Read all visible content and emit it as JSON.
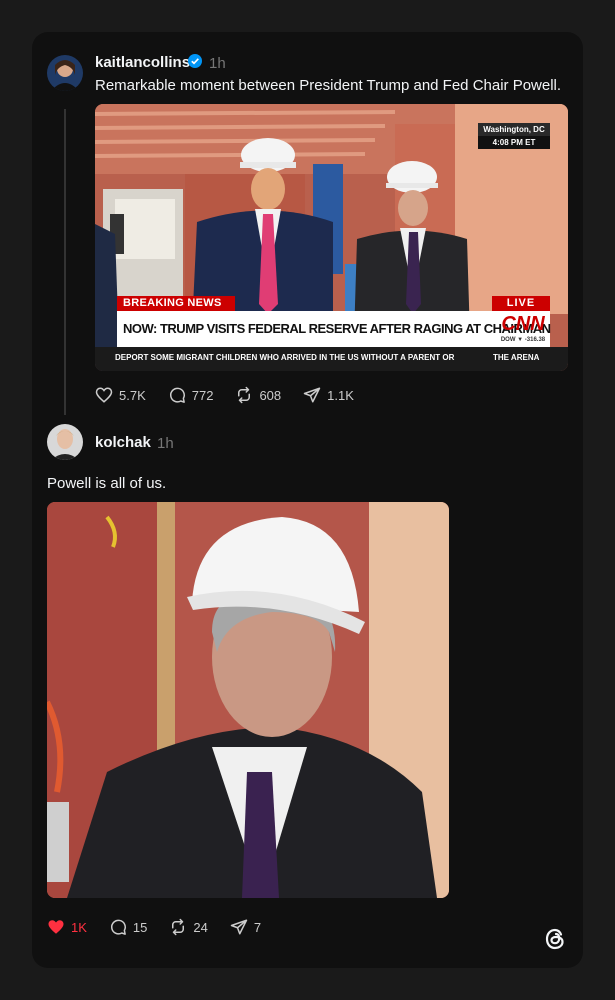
{
  "post1": {
    "username": "kaitlancollins",
    "time": "1h",
    "text": "Remarkable moment between President Trump and Fed Chair Powell.",
    "image": {
      "location": "Washington, DC",
      "clock": "4:08 PM ET",
      "breaking": "BREAKING NEWS",
      "live": "LIVE",
      "headline": "NOW: TRUMP VISITS FEDERAL RESERVE AFTER RAGING AT CHAIRMAN",
      "network": "CNN",
      "dow": "DOW ▼ -316.38",
      "ticker": "DEPORT SOME MIGRANT CHILDREN WHO ARRIVED IN THE US WITHOUT A PARENT OR",
      "ticker_brand": "THE ARENA"
    },
    "likes": "5.7K",
    "replies": "772",
    "reposts": "608",
    "shares": "1.1K"
  },
  "post2": {
    "username": "kolchak",
    "time": "1h",
    "text": "Powell is all of us.",
    "likes": "1K",
    "replies": "15",
    "reposts": "24",
    "shares": "7"
  },
  "colors": {
    "background": "#1a1a1a",
    "card": "#101010",
    "like_red": "#ff3040",
    "verified_blue": "#0095f6"
  }
}
